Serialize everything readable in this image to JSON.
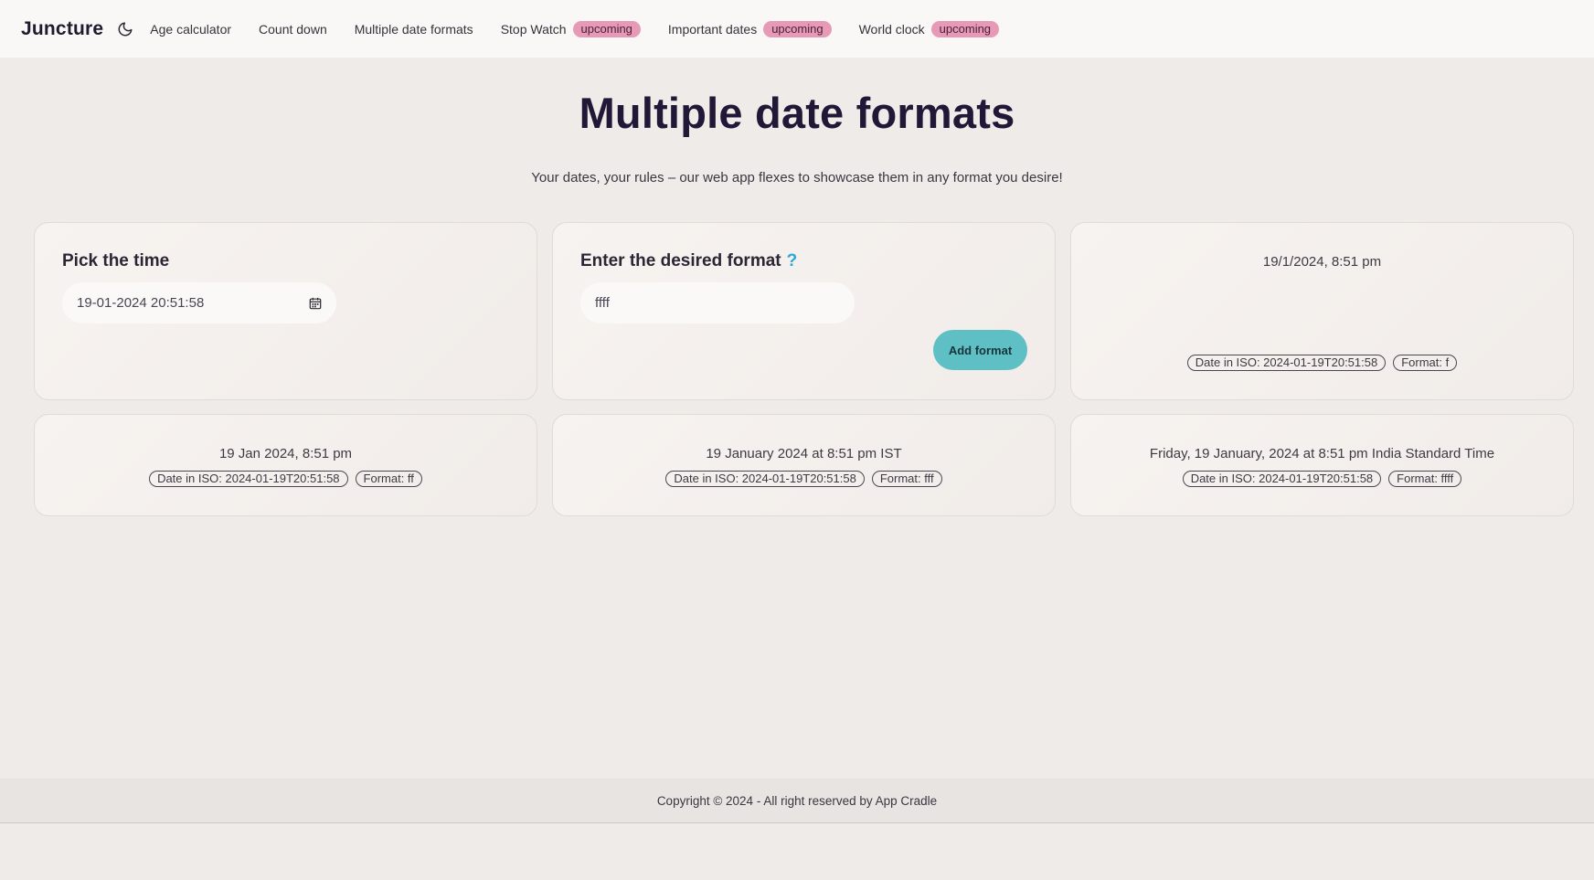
{
  "nav": {
    "brand": "Juncture",
    "theme_icon": "moon-icon",
    "items": [
      {
        "label": "Age calculator"
      },
      {
        "label": "Count down"
      },
      {
        "label": "Multiple date formats"
      },
      {
        "label": "Stop Watch",
        "badge": "upcoming"
      },
      {
        "label": "Important dates",
        "badge": "upcoming"
      },
      {
        "label": "World clock",
        "badge": "upcoming"
      }
    ]
  },
  "page": {
    "title": "Multiple date formats",
    "subtitle": "Your dates, your rules – our web app flexes to showcase them in any format you desire!"
  },
  "picker": {
    "title": "Pick the time",
    "value": "19-01-2024 20:51:58",
    "icon": "calendar-icon"
  },
  "format_input": {
    "title": "Enter the desired format",
    "help": "?",
    "value": "ffff",
    "button": "Add format"
  },
  "results": [
    {
      "display": "19/1/2024, 8:51 pm",
      "iso": "Date in ISO: 2024-01-19T20:51:58",
      "format": "Format: f"
    },
    {
      "display": "19 Jan 2024, 8:51 pm",
      "iso": "Date in ISO: 2024-01-19T20:51:58",
      "format": "Format: ff"
    },
    {
      "display": "19 January 2024 at 8:51 pm IST",
      "iso": "Date in ISO: 2024-01-19T20:51:58",
      "format": "Format: fff"
    },
    {
      "display": "Friday, 19 January, 2024 at 8:51 pm India Standard Time",
      "iso": "Date in ISO: 2024-01-19T20:51:58",
      "format": "Format: ffff"
    }
  ],
  "footer": {
    "text": "Copyright © 2024 - All right reserved by App Cradle"
  },
  "colors": {
    "accent": "#5ec0c4",
    "badge": "#e79ab7",
    "title": "#231737",
    "help": "#30a6d8"
  }
}
